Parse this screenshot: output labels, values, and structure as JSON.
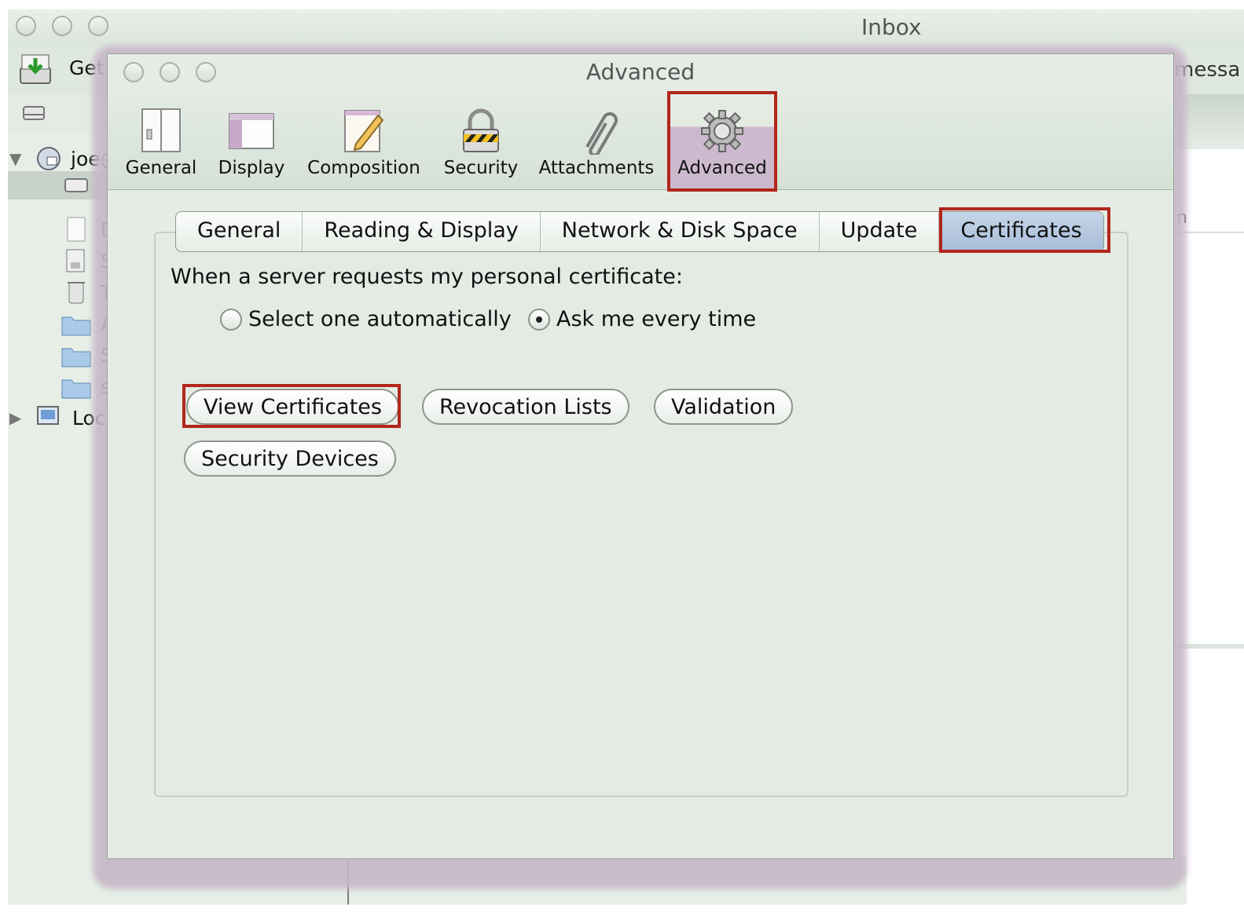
{
  "main_window": {
    "title": "Inbox",
    "toolbar": {
      "get_label": "Get",
      "messages_fragment": "messa"
    },
    "sidebar": {
      "account": "joe@",
      "folder_initials": [
        "D",
        "S",
        "T",
        "A",
        "S",
        "s"
      ],
      "local": "Loc"
    },
    "column_fragment": "n"
  },
  "dialog": {
    "title": "Advanced",
    "toolbar": [
      {
        "label": "General",
        "icon": "general-icon"
      },
      {
        "label": "Display",
        "icon": "display-icon"
      },
      {
        "label": "Composition",
        "icon": "composition-icon"
      },
      {
        "label": "Security",
        "icon": "lock-icon"
      },
      {
        "label": "Attachments",
        "icon": "paperclip-icon"
      },
      {
        "label": "Advanced",
        "icon": "gear-icon",
        "selected": true
      }
    ],
    "tabs": [
      {
        "label": "General"
      },
      {
        "label": "Reading & Display"
      },
      {
        "label": "Network & Disk Space"
      },
      {
        "label": "Update"
      },
      {
        "label": "Certificates",
        "selected": true
      }
    ],
    "certificates": {
      "prompt": "When a server requests my personal certificate:",
      "option_auto": "Select one automatically",
      "option_ask": "Ask me every time",
      "selected_option": "Ask me every time",
      "buttons": {
        "view": "View Certificates",
        "revocation": "Revocation Lists",
        "validation": "Validation",
        "devices": "Security Devices"
      }
    }
  },
  "colors": {
    "highlight_box": "#b1261c",
    "selected_tab": "#a6bcd8",
    "window_bg": "#e5ece5"
  }
}
